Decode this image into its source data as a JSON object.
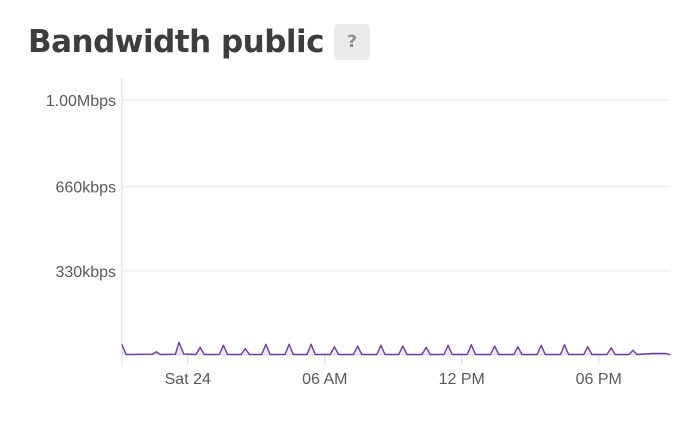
{
  "panel": {
    "title": "Bandwidth public",
    "help_label": "?"
  },
  "chart_data": {
    "type": "line",
    "title": "Bandwidth public",
    "xlabel": "",
    "ylabel": "",
    "y_unit": "bps",
    "ylim": [
      0,
      1000000
    ],
    "y_ticks": [
      {
        "value": 330000,
        "label": "330kbps"
      },
      {
        "value": 660000,
        "label": "660kbps"
      },
      {
        "value": 1000000,
        "label": "1.00Mbps"
      }
    ],
    "x_ticks": [
      {
        "value": 3.0,
        "label": "Sat 24"
      },
      {
        "value": 8.0,
        "label": "06 AM"
      },
      {
        "value": 13.0,
        "label": "12 PM"
      },
      {
        "value": 18.0,
        "label": "06 PM"
      }
    ],
    "xlim": [
      0.6,
      20.6
    ],
    "grid": true,
    "colors": {
      "series": "#6b3fa0",
      "grid": "#e6e6e6",
      "axis": "#d8d8d8"
    },
    "series": [
      {
        "values": [
          [
            0.6,
            40000
          ],
          [
            0.75,
            2000
          ],
          [
            1.7,
            3000
          ],
          [
            1.85,
            12000
          ],
          [
            2.0,
            2000
          ],
          [
            2.55,
            3000
          ],
          [
            2.68,
            50000
          ],
          [
            2.85,
            4000
          ],
          [
            3.3,
            2000
          ],
          [
            3.45,
            30000
          ],
          [
            3.6,
            2000
          ],
          [
            4.15,
            2000
          ],
          [
            4.3,
            38000
          ],
          [
            4.45,
            2000
          ],
          [
            4.95,
            2000
          ],
          [
            5.1,
            25000
          ],
          [
            5.25,
            2000
          ],
          [
            5.7,
            2000
          ],
          [
            5.85,
            42000
          ],
          [
            6.0,
            2000
          ],
          [
            6.55,
            2000
          ],
          [
            6.7,
            42000
          ],
          [
            6.85,
            2000
          ],
          [
            7.35,
            2000
          ],
          [
            7.5,
            42000
          ],
          [
            7.65,
            2000
          ],
          [
            8.2,
            2000
          ],
          [
            8.35,
            32000
          ],
          [
            8.5,
            2000
          ],
          [
            9.05,
            2000
          ],
          [
            9.2,
            35000
          ],
          [
            9.35,
            2000
          ],
          [
            9.9,
            2000
          ],
          [
            10.05,
            38000
          ],
          [
            10.2,
            2000
          ],
          [
            10.7,
            2000
          ],
          [
            10.85,
            35000
          ],
          [
            11.0,
            2000
          ],
          [
            11.55,
            2000
          ],
          [
            11.7,
            30000
          ],
          [
            11.85,
            2000
          ],
          [
            12.35,
            2000
          ],
          [
            12.5,
            38000
          ],
          [
            12.65,
            2000
          ],
          [
            13.2,
            2000
          ],
          [
            13.35,
            40000
          ],
          [
            13.5,
            2000
          ],
          [
            14.05,
            2000
          ],
          [
            14.2,
            35000
          ],
          [
            14.35,
            2000
          ],
          [
            14.9,
            2000
          ],
          [
            15.05,
            32000
          ],
          [
            15.2,
            2000
          ],
          [
            15.75,
            2000
          ],
          [
            15.9,
            38000
          ],
          [
            16.05,
            2000
          ],
          [
            16.6,
            2000
          ],
          [
            16.75,
            40000
          ],
          [
            16.9,
            2000
          ],
          [
            17.45,
            2000
          ],
          [
            17.6,
            32000
          ],
          [
            17.75,
            2000
          ],
          [
            18.3,
            2000
          ],
          [
            18.45,
            28000
          ],
          [
            18.6,
            2000
          ],
          [
            19.1,
            2000
          ],
          [
            19.25,
            18000
          ],
          [
            19.4,
            2000
          ],
          [
            19.95,
            6000
          ],
          [
            20.45,
            6000
          ],
          [
            20.6,
            2000
          ]
        ]
      }
    ]
  }
}
